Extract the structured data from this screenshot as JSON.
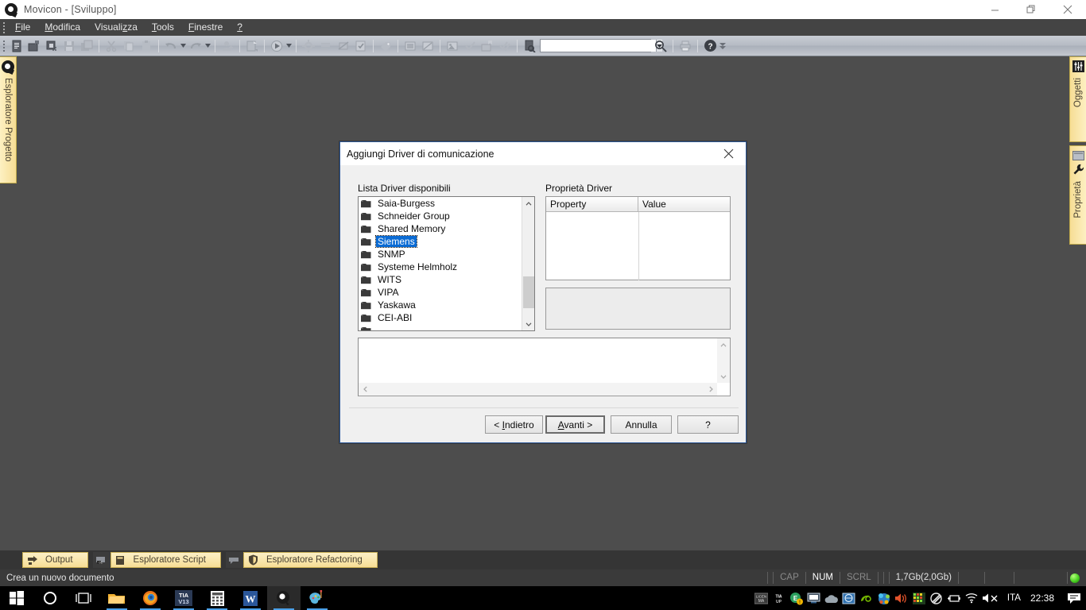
{
  "window": {
    "title": "Movicon - [Sviluppo]",
    "app_icon": "movicon-icon",
    "minimize_label": "Minimize",
    "maximize_label": "Restore",
    "close_label": "Close"
  },
  "menubar": {
    "items": [
      {
        "label": "File",
        "accel": "F"
      },
      {
        "label": "Modifica",
        "accel": "M"
      },
      {
        "label": "Visualizza",
        "accel": "z"
      },
      {
        "label": "Tools",
        "accel": "T"
      },
      {
        "label": "Finestre",
        "accel": "F"
      },
      {
        "label": "?",
        "accel": "?"
      }
    ]
  },
  "toolbar": {
    "icons": [
      "new-document-icon",
      "open-project-icon",
      "save-resource-icon",
      "save-icon",
      "save-all-icon",
      "cut-icon",
      "copy-icon",
      "paste-icon",
      "undo-icon",
      "undo-dropdown-icon",
      "redo-icon",
      "redo-dropdown-icon",
      "add-user-icon",
      "build-icon",
      "run-icon",
      "run-dropdown-icon",
      "settings-icon",
      "debug-icon",
      "watch-icon",
      "validate-icon",
      "tag-icon",
      "screen-icon",
      "form-icon",
      "image-icon",
      "check-icon",
      "deploy-icon",
      "checkall-icon",
      "find-in-files-icon"
    ],
    "search_value": "",
    "search_placeholder": "",
    "search_button": "search-icon",
    "print_button": "print-icon",
    "help_button": "help-icon",
    "overflow_button": "toolbar-overflow-icon"
  },
  "docks": {
    "left": [
      {
        "label": "Esploratore Progetto",
        "icon": "movicon-icon"
      }
    ],
    "right": [
      {
        "label": "Oggetti",
        "icon": "sliders-icon"
      },
      {
        "label": "Proprietà",
        "icon": "wrench-icon"
      }
    ]
  },
  "dialog": {
    "title": "Aggiungi Driver di comunicazione",
    "close_icon": "close-icon",
    "list_label": "Lista Driver disponibili",
    "properties_label": "Proprietà Driver",
    "drivers": [
      {
        "name": "Saia-Burgess",
        "selected": false
      },
      {
        "name": "Schneider Group",
        "selected": false
      },
      {
        "name": "Shared Memory",
        "selected": false
      },
      {
        "name": "Siemens",
        "selected": true
      },
      {
        "name": "SNMP",
        "selected": false
      },
      {
        "name": "Systeme Helmholz",
        "selected": false
      },
      {
        "name": "WITS",
        "selected": false
      },
      {
        "name": "VIPA",
        "selected": false
      },
      {
        "name": "Yaskawa",
        "selected": false
      },
      {
        "name": "CEI-ABI",
        "selected": false
      },
      {
        "name": "",
        "selected": false
      }
    ],
    "grid": {
      "columns": [
        "Property",
        "Value"
      ],
      "rows": []
    },
    "description": "",
    "buttons": {
      "back": "< Indietro",
      "next": "Avanti >",
      "cancel": "Annulla",
      "help": "?"
    }
  },
  "bottom_tabs": [
    {
      "label": "Output",
      "icon": "output-icon",
      "pre_icon": null
    },
    {
      "label": "Esploratore Script",
      "icon": "script-icon",
      "pre_icon": "script-pre-icon"
    },
    {
      "label": "Esploratore Refactoring",
      "icon": "shield-icon",
      "pre_icon": "refactoring-pre-icon"
    }
  ],
  "statusbar": {
    "message": "Crea un nuovo documento",
    "cap": "CAP",
    "num": "NUM",
    "scrl": "SCRL",
    "memory": "1,7Gb(2,0Gb)",
    "led": "status-led-green"
  },
  "taskbar": {
    "items": [
      {
        "name": "start-button",
        "icon": "windows-logo-icon",
        "active": false,
        "running": false
      },
      {
        "name": "cortana-button",
        "icon": "cortana-circle-icon",
        "active": false,
        "running": false
      },
      {
        "name": "task-view-button",
        "icon": "task-view-icon",
        "active": false,
        "running": false
      },
      {
        "name": "file-explorer-button",
        "icon": "folder-icon",
        "active": false,
        "running": true
      },
      {
        "name": "firefox-button",
        "icon": "firefox-icon",
        "active": false,
        "running": true
      },
      {
        "name": "tia-portal-button",
        "icon": "tia-v13-icon",
        "active": false,
        "running": true
      },
      {
        "name": "calculator-button",
        "icon": "calculator-icon",
        "active": false,
        "running": true
      },
      {
        "name": "word-button",
        "icon": "word-icon",
        "active": false,
        "running": true
      },
      {
        "name": "movicon-button",
        "icon": "movicon-icon",
        "active": true,
        "running": true
      },
      {
        "name": "paint-button",
        "icon": "paint-icon",
        "active": false,
        "running": true
      }
    ],
    "tray": [
      "license-manager-icon",
      "tia-updater-icon",
      "update-alert-icon",
      "display-icon",
      "onedrive-icon",
      "network-share-icon",
      "nvidia-icon",
      "bluetooth-icon",
      "speaker-icon",
      "color-grid-icon",
      "storage-icon",
      "battery-icon",
      "wifi-icon",
      "volume-muted-icon"
    ],
    "language": "ITA",
    "clock": "22:38",
    "action_center": "action-center-icon"
  }
}
